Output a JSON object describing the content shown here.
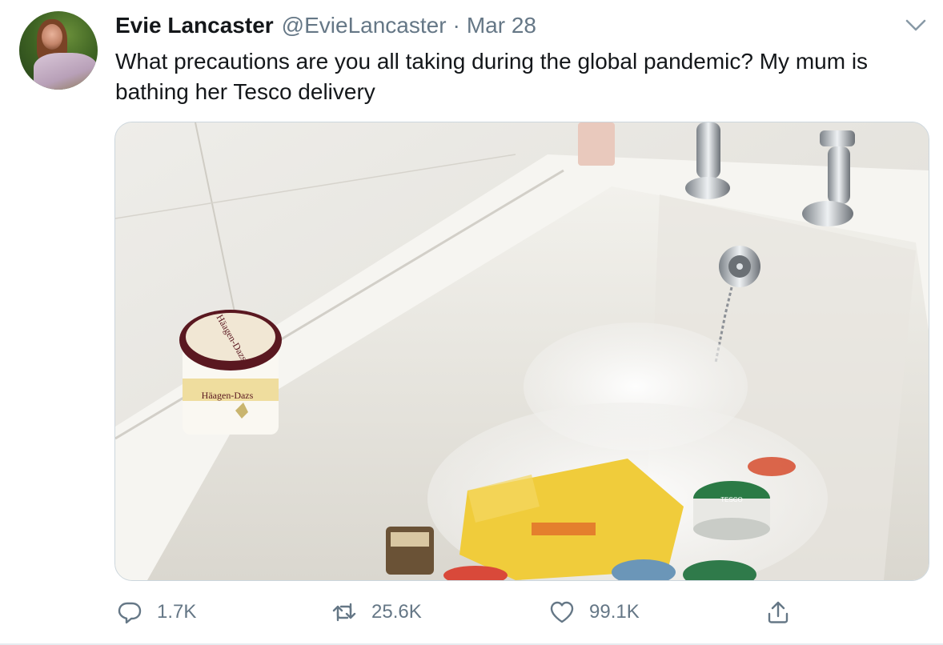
{
  "tweet": {
    "author_name": "Evie Lancaster",
    "author_handle": "@EvieLancaster",
    "separator": "·",
    "date": "Mar 28",
    "text": "What precautions are you all taking during the global pandemic? My mum is bathing her Tesco delivery",
    "media": {
      "icon": "photo",
      "product_labels": {
        "ice_cream": "Häagen-Dazs",
        "tub_lid": "Häagen-Dazs",
        "pot_label": "TESCO"
      }
    },
    "actions": {
      "reply": {
        "icon": "reply-icon",
        "count": "1.7K"
      },
      "retweet": {
        "icon": "retweet-icon",
        "count": "25.6K"
      },
      "like": {
        "icon": "heart-icon",
        "count": "99.1K"
      },
      "share": {
        "icon": "share-icon"
      }
    }
  },
  "colors": {
    "text_primary": "#14171a",
    "text_secondary": "#657786",
    "border": "#ccd6dd"
  }
}
